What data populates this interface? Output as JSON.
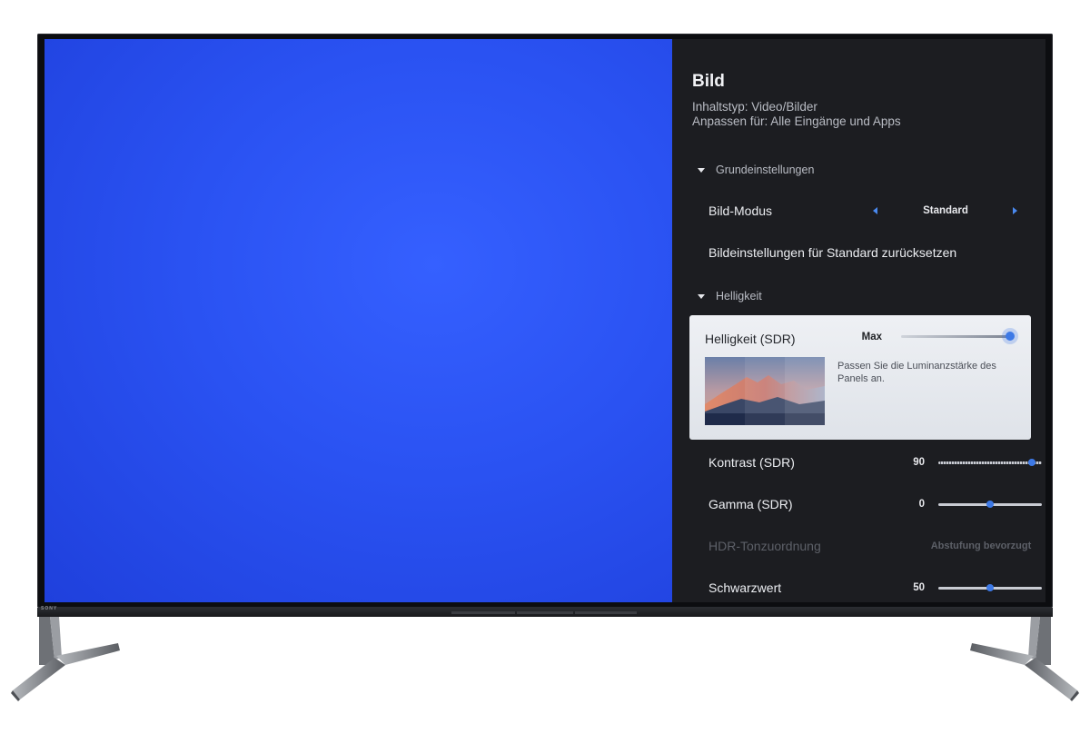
{
  "brand": {
    "logo_text": "SONY"
  },
  "panel": {
    "title": "Bild",
    "content_type": "Inhaltstyp: Video/Bilder",
    "adjust_for": "Anpassen für: Alle Eingänge und Apps"
  },
  "sections": {
    "basic": "Grundeinstellungen",
    "brightness": "Helligkeit"
  },
  "picture_mode": {
    "label": "Bild-Modus",
    "value": "Standard"
  },
  "reset": {
    "label": "Bildeinstellungen für Standard zurücksetzen"
  },
  "brightness_sdr": {
    "label": "Helligkeit (SDR)",
    "value": "Max",
    "level": 1.0,
    "description": "Passen Sie die Luminanzstärke des Panels an."
  },
  "contrast": {
    "label": "Kontrast (SDR)",
    "value": "90",
    "level": 0.9
  },
  "gamma": {
    "label": "Gamma (SDR)",
    "value": "0",
    "level": 0.5
  },
  "hdr_tone": {
    "label": "HDR-Tonzuordnung",
    "value": "Abstufung bevorzugt"
  },
  "black_level": {
    "label": "Schwarzwert",
    "value": "50",
    "level": 0.5
  },
  "colors": {
    "accent": "#3d79e6",
    "screen_blue": "#2a52f2",
    "panel_bg": "#1c1d21"
  }
}
